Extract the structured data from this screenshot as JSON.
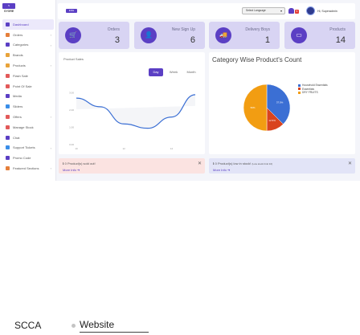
{
  "app": {
    "logo_text": "SYGRE",
    "logo_badge": "S"
  },
  "sidebar": {
    "items": [
      {
        "label": "Dashboard",
        "color": "#5b3fc4",
        "active": true,
        "chevron": false
      },
      {
        "label": "Orders",
        "color": "#e57f3a",
        "chevron": true
      },
      {
        "label": "Categories",
        "color": "#5b3fc4",
        "chevron": true
      },
      {
        "label": "Brands",
        "color": "#e8a33a",
        "chevron": false
      },
      {
        "label": "Products",
        "color": "#e8a33a",
        "chevron": true
      },
      {
        "label": "Flash Sale",
        "color": "#e25a5a",
        "chevron": false
      },
      {
        "label": "Point Of Sale",
        "color": "#e25a5a",
        "chevron": false
      },
      {
        "label": "Media",
        "color": "#5b3fc4",
        "chevron": false
      },
      {
        "label": "Sliders",
        "color": "#3a8ee8",
        "chevron": false
      },
      {
        "label": "Offers",
        "color": "#e25a5a",
        "chevron": true
      },
      {
        "label": "Manage Stock",
        "color": "#e25a5a",
        "chevron": false
      },
      {
        "label": "Chat",
        "color": "#5b3fc4",
        "chevron": false
      },
      {
        "label": "Support Tickets",
        "color": "#3a8ee8",
        "chevron": true
      },
      {
        "label": "Promo Code",
        "color": "#5b3fc4",
        "chevron": false
      },
      {
        "label": "Featured Sections",
        "color": "#e57f3a",
        "chevron": true
      }
    ]
  },
  "header": {
    "badge": "ENG",
    "language_select": "Select Language",
    "notification_count": "5",
    "user_name": "Hi, Superadmin"
  },
  "cards": [
    {
      "label": "Orders",
      "value": "3",
      "icon": "cart-icon",
      "glyph": "🛒"
    },
    {
      "label": "New Sign Up",
      "value": "6",
      "icon": "user-add-icon",
      "glyph": "👤"
    },
    {
      "label": "Delivery Boys",
      "value": "1",
      "icon": "delivery-icon",
      "glyph": "🚚"
    },
    {
      "label": "Products",
      "value": "14",
      "icon": "product-box-icon",
      "glyph": "▭"
    }
  ],
  "product_sales": {
    "title": "Product Sales",
    "tabs": [
      "Day",
      "Week",
      "Month"
    ],
    "active_tab": "Day"
  },
  "chart_data": [
    {
      "type": "line",
      "title": "Product Sales",
      "x": [
        "10",
        "11",
        "12",
        "13",
        "14",
        "15"
      ],
      "ytick_labels": [
        "3.00",
        "2.00",
        "1.00",
        "0.00"
      ],
      "ylim": [
        0,
        3.5
      ],
      "series": [
        {
          "values": [
            2.7,
            2.2,
            1.2,
            0.95,
            1.6,
            2.9
          ]
        }
      ],
      "color": "#3b6fd4",
      "grid": false
    },
    {
      "type": "pie",
      "title": "Category Wise Product's Count",
      "categories": [
        "Household Essentials",
        "Essentials",
        "DRY FRUITS"
      ],
      "values": [
        37.5,
        12.5,
        50.0
      ],
      "labels": [
        "37.5%",
        "12.5%",
        "50%"
      ],
      "colors": [
        "#3b6fd4",
        "#d9441e",
        "#f29d12"
      ],
      "legend": "right"
    }
  ],
  "alerts": {
    "sold_out": {
      "text": "0 Product(s) sold out!",
      "link": "More Info"
    },
    "low_stock": {
      "text": "0 Product(s) low in stock!",
      "note": "(Low stock limit 10)",
      "link": "More Info"
    }
  },
  "footer": {
    "brand": "SCCA",
    "link": "Website"
  }
}
